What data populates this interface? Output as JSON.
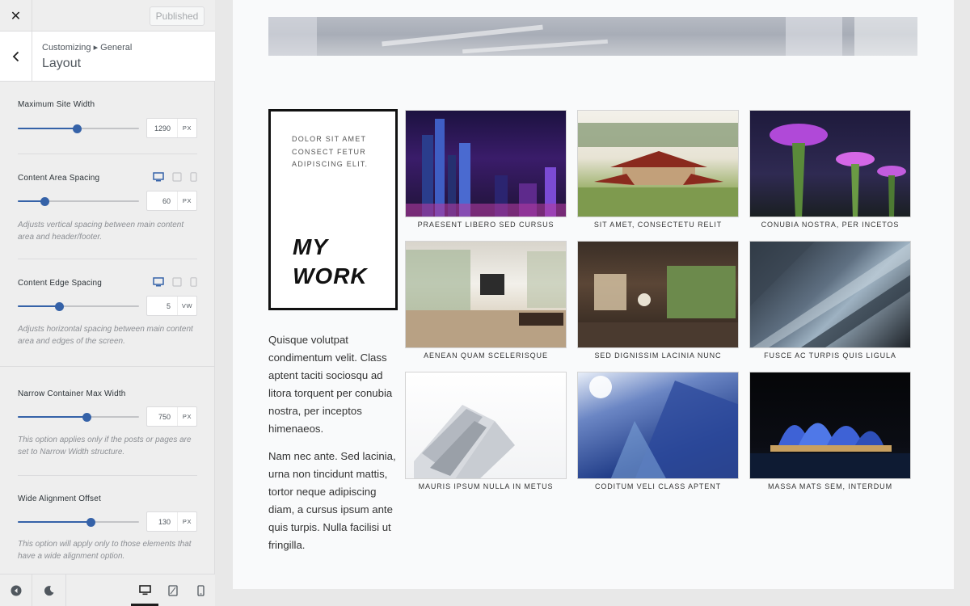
{
  "header": {
    "close_label": "✕",
    "publish_label": "Published"
  },
  "section": {
    "breadcrumb": "Customizing ▸ General",
    "title": "Layout"
  },
  "controls": {
    "max_site_width": {
      "label": "Maximum Site Width",
      "value": "1290",
      "unit": "PX",
      "fill": 0.49
    },
    "content_area_spacing": {
      "label": "Content Area Spacing",
      "value": "60",
      "unit": "PX",
      "fill": 0.22,
      "description": "Adjusts vertical spacing between main content area and header/footer."
    },
    "content_edge_spacing": {
      "label": "Content Edge Spacing",
      "value": "5",
      "unit": "VW",
      "fill": 0.34,
      "description": "Adjusts horizontal spacing between main content area and edges of the screen."
    },
    "narrow_container": {
      "label": "Narrow Container Max Width",
      "value": "750",
      "unit": "PX",
      "fill": 0.57,
      "description": "This option applies only if the posts or pages are set to Narrow Width structure."
    },
    "wide_alignment": {
      "label": "Wide Alignment Offset",
      "value": "130",
      "unit": "PX",
      "fill": 0.6,
      "description": "This option will apply only to those elements that have a wide alignment option."
    }
  },
  "preview": {
    "work_small": "DOLOR SIT AMET CONSECT FETUR ADIPISCING ELIT.",
    "work_title_line1": "MY",
    "work_title_line2": "WORK",
    "paragraph1": "Quisque volutpat condimentum velit. Class aptent taciti sociosqu ad litora torquent per conubia nostra, per inceptos himenaeos.",
    "paragraph2": "Nam nec ante. Sed lacinia, urna non tincidunt mattis, tortor neque adipiscing diam, a cursus ipsum ante quis turpis. Nulla facilisi ut fringilla.",
    "tiles": [
      {
        "caption": "PRAESENT LIBERO SED CURSUS",
        "scene": "city-night-skyline"
      },
      {
        "caption": "SIT AMET, CONSECTETU RELIT",
        "scene": "temple-garden"
      },
      {
        "caption": "CONUBIA NOSTRA, PER INCETOS",
        "scene": "supertree-grove"
      },
      {
        "caption": "AENEAN QUAM SCELERISQUE",
        "scene": "bright-living-room"
      },
      {
        "caption": "SED DIGNISSIM LACINIA NUNC",
        "scene": "wood-living-room"
      },
      {
        "caption": "FUSCE AC TURPIS QUIS LIGULA",
        "scene": "glass-facade"
      },
      {
        "caption": "MAURIS IPSUM NULLA IN METUS",
        "scene": "white-building"
      },
      {
        "caption": "CODITUM VELI CLASS APTENT",
        "scene": "blue-tower"
      },
      {
        "caption": "MASSA MATS SEM, INTERDUM",
        "scene": "opera-house"
      }
    ]
  },
  "colors": {
    "accent": "#3562a8",
    "sidebar_bg": "#eeeeee",
    "preview_bg": "#f9fafb"
  }
}
